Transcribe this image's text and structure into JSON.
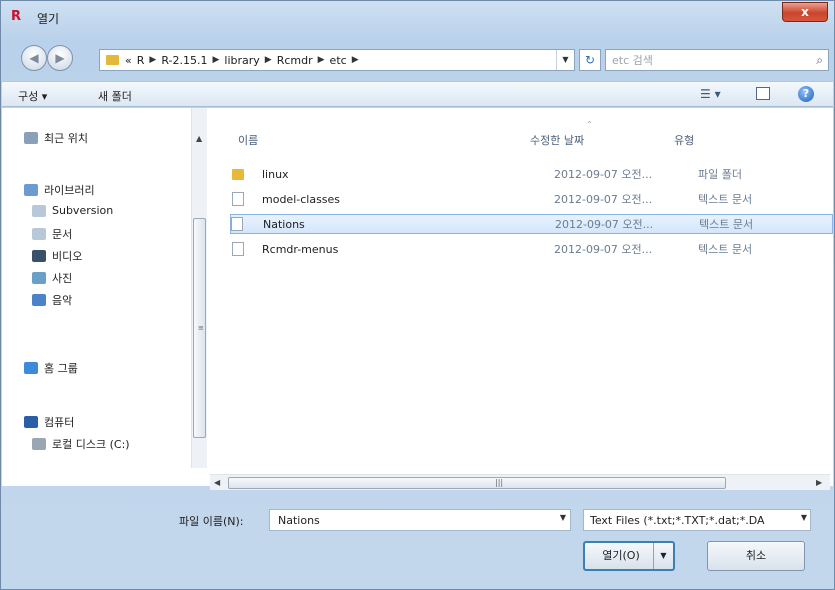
{
  "window": {
    "app_icon": "R",
    "title": "열기",
    "close_label": "x"
  },
  "address": {
    "crumbs": [
      "«",
      "R",
      "R-2.15.1",
      "library",
      "Rcmdr",
      "etc"
    ],
    "search_placeholder": "etc 검색"
  },
  "toolbar": {
    "organize": "구성 ▾",
    "new_folder": "새 폴더"
  },
  "sidebar": {
    "items": [
      {
        "label": "최근 위치",
        "icon": "recent-icon",
        "color": "#8aa0b8"
      },
      {
        "label": "라이브러리",
        "icon": "library-icon",
        "color": "#6c9bd0"
      },
      {
        "label": "Subversion",
        "icon": "folder-icon",
        "color": "#b9c8d8"
      },
      {
        "label": "문서",
        "icon": "documents-icon",
        "color": "#b9c8d8"
      },
      {
        "label": "비디오",
        "icon": "video-icon",
        "color": "#3a5068"
      },
      {
        "label": "사진",
        "icon": "pictures-icon",
        "color": "#6aa0c8"
      },
      {
        "label": "음악",
        "icon": "music-icon",
        "color": "#4d82c8"
      },
      {
        "label": "홈 그룹",
        "icon": "homegroup-icon",
        "color": "#3c8ad8"
      },
      {
        "label": "컴퓨터",
        "icon": "computer-icon",
        "color": "#2a5fa8"
      },
      {
        "label": "로컬 디스크 (C:)",
        "icon": "disk-icon",
        "color": "#9aa6b2"
      }
    ]
  },
  "columns": {
    "name": "이름",
    "date": "수정한 날짜",
    "type": "유형"
  },
  "files": [
    {
      "name": "linux",
      "date": "2012-09-07 오전...",
      "type": "파일 폴더",
      "kind": "folder",
      "selected": false
    },
    {
      "name": "model-classes",
      "date": "2012-09-07 오전...",
      "type": "텍스트 문서",
      "kind": "doc",
      "selected": false
    },
    {
      "name": "Nations",
      "date": "2012-09-07 오전...",
      "type": "텍스트 문서",
      "kind": "doc",
      "selected": true
    },
    {
      "name": "Rcmdr-menus",
      "date": "2012-09-07 오전...",
      "type": "텍스트 문서",
      "kind": "doc",
      "selected": false
    }
  ],
  "bottom": {
    "filename_label": "파일 이름(N):",
    "filename_value": "Nations",
    "filter_value": "Text Files (*.txt;*.TXT;*.dat;*.DA",
    "open_label": "열기(O)",
    "cancel_label": "취소"
  },
  "colors": {
    "selection_border": "#88b5e6",
    "close_button": "#c9452c"
  }
}
